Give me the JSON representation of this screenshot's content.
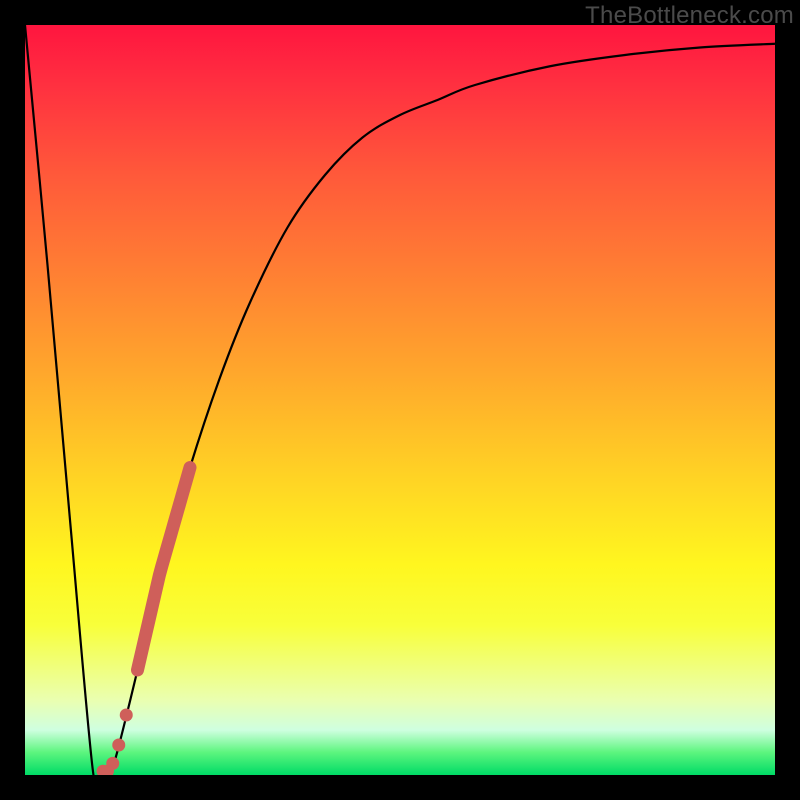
{
  "watermark": "TheBottleneck.com",
  "chart_data": {
    "type": "line",
    "title": "",
    "xlabel": "",
    "ylabel": "",
    "xlim": [
      0,
      100
    ],
    "ylim": [
      0,
      100
    ],
    "series": [
      {
        "name": "bottleneck-curve",
        "x": [
          0,
          3,
          6,
          9,
          10,
          11,
          12,
          15,
          18,
          22,
          26,
          30,
          35,
          40,
          45,
          50,
          55,
          60,
          70,
          80,
          90,
          100
        ],
        "values": [
          100,
          68,
          34,
          1,
          0.5,
          0.5,
          2,
          14,
          27,
          41,
          53,
          63,
          73,
          80,
          85,
          88,
          90,
          92,
          94.5,
          96,
          97,
          97.5
        ]
      }
    ],
    "markers": [
      {
        "name": "marker-segment",
        "x_from": 15,
        "x_to": 22,
        "thick": true
      },
      {
        "name": "marker-dot",
        "x": 13.5
      },
      {
        "name": "marker-dot",
        "x": 12.5
      },
      {
        "name": "marker-dot",
        "x": 11.7
      },
      {
        "name": "marker-dot",
        "x": 11.0
      },
      {
        "name": "marker-dot",
        "x": 10.4
      }
    ],
    "colors": {
      "curve": "#000000",
      "marker": "#cf5f5a"
    }
  }
}
